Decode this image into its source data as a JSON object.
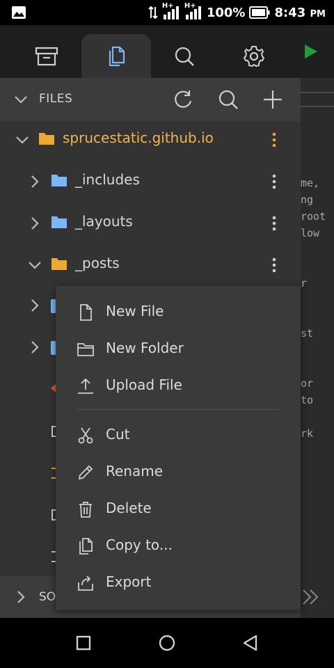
{
  "status_bar": {
    "signal_label": "H+",
    "battery": "100%",
    "time": "8:43",
    "ampm": "PM"
  },
  "tabs": [
    {
      "icon": "archive-icon",
      "active": false
    },
    {
      "icon": "files-icon",
      "active": true
    },
    {
      "icon": "search-icon",
      "active": false
    },
    {
      "icon": "gear-icon",
      "active": false
    }
  ],
  "files_panel": {
    "title": "FILES"
  },
  "tree": [
    {
      "name": "sprucestatic.github.io",
      "color": "#f0a830",
      "expanded": true
    },
    {
      "name": "_includes",
      "color": "#7ab7f5",
      "expanded": false
    },
    {
      "name": "_layouts",
      "color": "#7ab7f5",
      "expanded": false
    },
    {
      "name": "_posts",
      "color": "#f0a830",
      "expanded": true
    }
  ],
  "bottom_panel": {
    "label": "SO"
  },
  "editor": {
    "lines": [
      "me,",
      "ng",
      "root",
      "low",
      "r",
      "st",
      "or",
      "to",
      "rk"
    ]
  },
  "context_menu": {
    "items": [
      {
        "label": "New File",
        "icon": "file-icon"
      },
      {
        "label": "New Folder",
        "icon": "folder-icon"
      },
      {
        "label": "Upload File",
        "icon": "upload-icon"
      },
      {
        "label": "Cut",
        "icon": "scissors-icon"
      },
      {
        "label": "Rename",
        "icon": "pencil-icon"
      },
      {
        "label": "Delete",
        "icon": "trash-icon"
      },
      {
        "label": "Copy to...",
        "icon": "copy-icon"
      },
      {
        "label": "Export",
        "icon": "share-icon"
      }
    ]
  },
  "colors": {
    "accent": "#7ab7f5",
    "folder_yellow": "#f0a830",
    "run_green": "#1f9e3e"
  }
}
